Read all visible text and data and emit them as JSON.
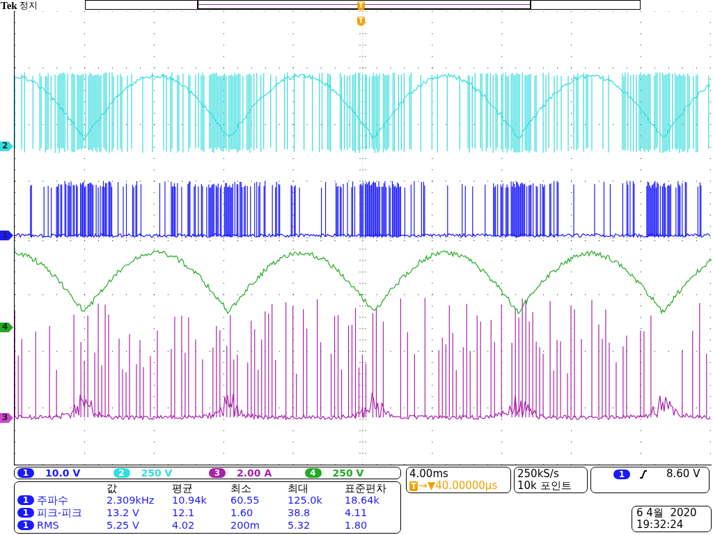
{
  "header": {
    "brand": "Tek",
    "status": "정지"
  },
  "trigger_markers": [
    "T",
    "T"
  ],
  "channel_markers": [
    {
      "label": "2",
      "color": "#33dddd"
    },
    {
      "label": "1",
      "color": "#1a1aff"
    },
    {
      "label": "4",
      "color": "#22aa22"
    },
    {
      "label": "3",
      "color": "#cc44cc"
    }
  ],
  "channels": [
    {
      "number": "1",
      "scale": "10.0 V",
      "color": "#1a1aff"
    },
    {
      "number": "2",
      "scale": "250 V",
      "color": "#33dddd"
    },
    {
      "number": "3",
      "scale": "2.00 A",
      "color": "#aa22aa"
    },
    {
      "number": "4",
      "scale": "250 V",
      "color": "#22aa22"
    }
  ],
  "measurements": {
    "columns": [
      "값",
      "평균",
      "최소",
      "최대",
      "표준편차"
    ],
    "rows": [
      {
        "source": "1",
        "name": "주파수",
        "values": [
          "2.309kHz",
          "10.94k",
          "60.55",
          "125.0k",
          "18.64k"
        ]
      },
      {
        "source": "1",
        "name": "피크-피크",
        "values": [
          "13.2 V",
          "12.1",
          "1.60",
          "38.8",
          "4.11"
        ]
      },
      {
        "source": "1",
        "name": "RMS",
        "values": [
          "5.25 V",
          "4.02",
          "200m",
          "5.32",
          "1.80"
        ]
      }
    ]
  },
  "timebase": {
    "scale": "4.00ms",
    "delay_marker": "T",
    "delay": "→▼40.00000µs"
  },
  "acquisition": {
    "rate": "250kS/s",
    "points": "10k 포인트"
  },
  "trigger": {
    "source": "1",
    "level": "8.60 V"
  },
  "datetime": {
    "date": "6 4월  2020",
    "time": "19:32:24"
  }
}
